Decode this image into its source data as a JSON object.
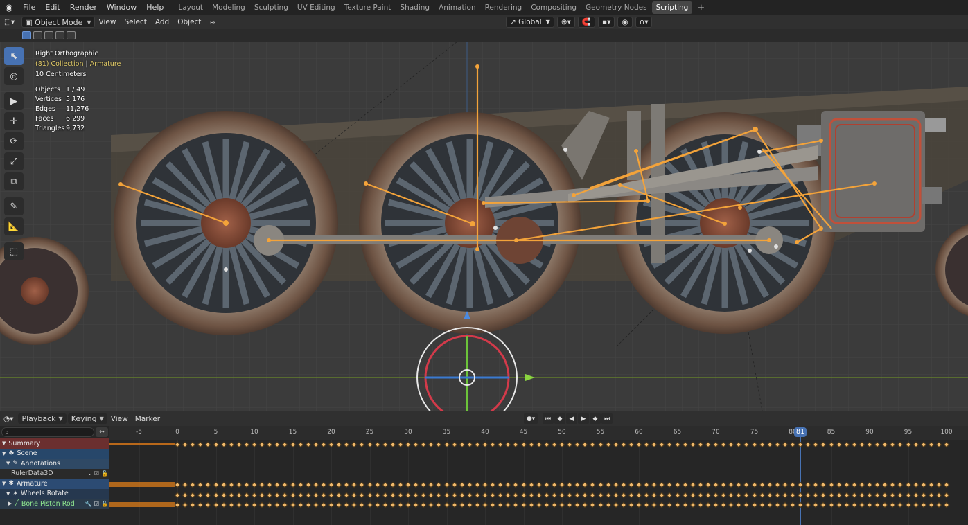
{
  "topbar": {
    "menus": [
      "File",
      "Edit",
      "Render",
      "Window",
      "Help"
    ],
    "workspaces": [
      "Layout",
      "Modeling",
      "Sculpting",
      "UV Editing",
      "Texture Paint",
      "Shading",
      "Animation",
      "Rendering",
      "Compositing",
      "Geometry Nodes",
      "Scripting"
    ],
    "active_workspace": "Scripting",
    "add_label": "+"
  },
  "viewport_header": {
    "mode": "Object Mode",
    "menus": [
      "View",
      "Select",
      "Add",
      "Object"
    ],
    "transform_orientation": "Global"
  },
  "viewport": {
    "view_name": "Right Orthographic",
    "collection_line_prefix": "(81) Collection",
    "collection_line_sep": " | ",
    "active_object": "Armature",
    "grid_scale": "10 Centimeters",
    "stats": [
      {
        "label": "Objects",
        "value": "1 / 49"
      },
      {
        "label": "Vertices",
        "value": "5,176"
      },
      {
        "label": "Edges",
        "value": "11,276"
      },
      {
        "label": "Faces",
        "value": "6,299"
      },
      {
        "label": "Triangles",
        "value": "9,732"
      }
    ],
    "tools": [
      "select-box-icon",
      "cursor-icon",
      "move-icon",
      "rotate-icon",
      "scale-icon",
      "transform-icon",
      "annotate-icon",
      "measure-icon",
      "add-cube-icon"
    ]
  },
  "timeline_header": {
    "menus": [
      "Playback",
      "Keying",
      "View",
      "Marker"
    ]
  },
  "dopesheet": {
    "search_placeholder": "",
    "current_frame": "81",
    "ticks": [
      "-5",
      "0",
      "5",
      "10",
      "15",
      "20",
      "25",
      "30",
      "35",
      "40",
      "45",
      "50",
      "55",
      "60",
      "65",
      "70",
      "75",
      "80",
      "85",
      "90",
      "95",
      "100"
    ],
    "channels": {
      "summary": "Summary",
      "scene": "Scene",
      "annotations": "Annotations",
      "ruler": "RulerData3D",
      "armature": "Armature",
      "wheels": "Wheels Rotate",
      "bone": "Bone Piston Rod"
    }
  }
}
